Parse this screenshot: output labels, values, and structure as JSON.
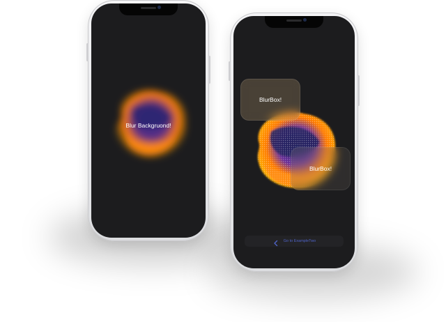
{
  "left_phone": {
    "center_label": "Blur Backgruond!"
  },
  "right_phone": {
    "blur_box_top": "BlurBox!",
    "blur_box_bottom": "BlurBox!",
    "nav_back_label": "Go to ExampleTwo",
    "nav_icon": "chevron-left-icon"
  },
  "colors": {
    "screen_bg": "#1c1c1e",
    "accent_link": "#4f63c8",
    "blob_orange": "#ff7a00",
    "blob_purple": "#3a2e8a"
  }
}
